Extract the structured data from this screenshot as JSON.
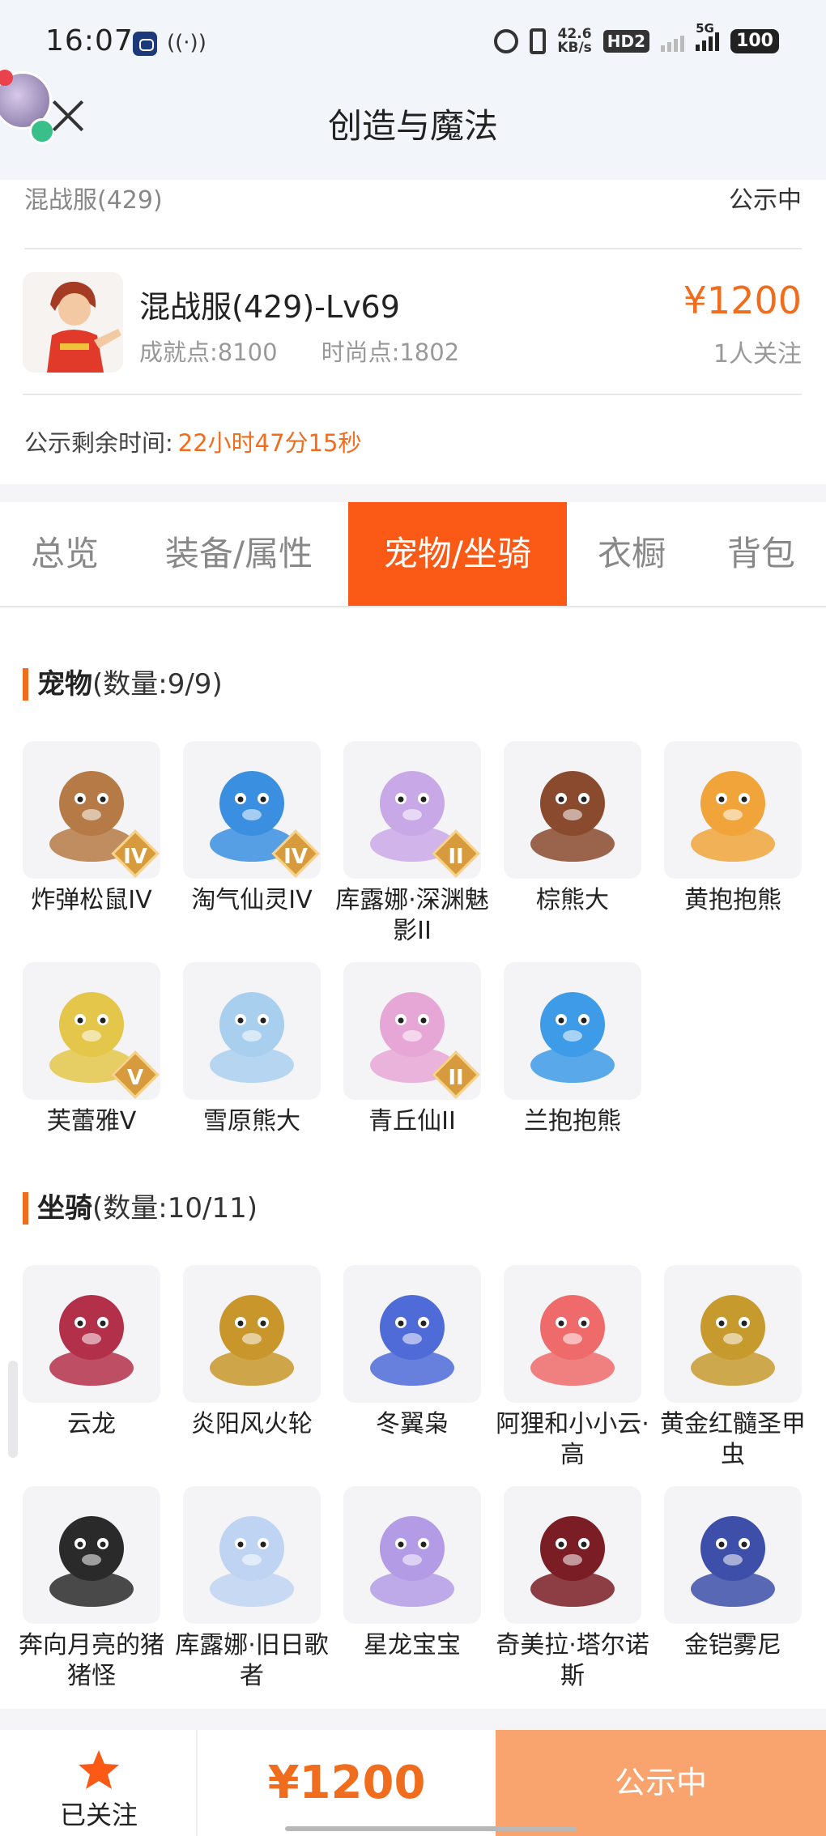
{
  "status_bar": {
    "time": "16:07",
    "net_speed_value": "42.6",
    "net_speed_unit": "KB/s",
    "hd_label": "HD2",
    "signal_label": "5G",
    "battery": "100"
  },
  "header": {
    "title": "创造与魔法"
  },
  "listing": {
    "server_label": "混战服(429)",
    "state": "公示中",
    "account_name": "混战服(429)-Lv69",
    "achievement": "成就点:8100",
    "fashion": "时尚点:1802",
    "price": "¥1200",
    "followers": "1人关注",
    "remaining_label": "公示剩余时间:",
    "remaining_value": "22小时47分15秒"
  },
  "tabs": [
    {
      "label": "总览"
    },
    {
      "label": "装备/属性"
    },
    {
      "label": "宠物/坐骑"
    },
    {
      "label": "衣橱"
    },
    {
      "label": "背包"
    }
  ],
  "pets": {
    "title": "宠物",
    "count": "(数量:9/9)",
    "items": [
      {
        "name": "炸弹松鼠IV",
        "rank": "IV",
        "color": "#b57a45"
      },
      {
        "name": "淘气仙灵IV",
        "rank": "IV",
        "color": "#3b8fe0"
      },
      {
        "name": "库露娜·深渊魅影II",
        "rank": "II",
        "color": "#c9a8e8"
      },
      {
        "name": "棕熊大",
        "rank": "",
        "color": "#8a4a2e"
      },
      {
        "name": "黄抱抱熊",
        "rank": "",
        "color": "#f0a43a"
      },
      {
        "name": "芙蕾雅V",
        "rank": "V",
        "color": "#e3c64a"
      },
      {
        "name": "雪原熊大",
        "rank": "",
        "color": "#a9cfee"
      },
      {
        "name": "青丘仙II",
        "rank": "II",
        "color": "#e6a7d6"
      },
      {
        "name": "兰抱抱熊",
        "rank": "",
        "color": "#3d9be8"
      }
    ]
  },
  "mounts": {
    "title": "坐骑",
    "count": "(数量:10/11)",
    "items": [
      {
        "name": "云龙",
        "color": "#b3304a"
      },
      {
        "name": "炎阳风火轮",
        "color": "#c8962a"
      },
      {
        "name": "冬翼枭",
        "color": "#4e6bd8"
      },
      {
        "name": "阿狸和小小云·高",
        "color": "#ef6b6b"
      },
      {
        "name": "黄金红髓圣甲虫",
        "color": "#c79a2e"
      },
      {
        "name": "奔向月亮的猪猪怪",
        "color": "#2a2a2a"
      },
      {
        "name": "库露娜·旧日歌者",
        "color": "#bfd4f2"
      },
      {
        "name": "星龙宝宝",
        "color": "#b49be6"
      },
      {
        "name": "奇美拉·塔尔诺斯",
        "color": "#7a1d24"
      },
      {
        "name": "金铠雾尼",
        "color": "#3d4fa8"
      }
    ]
  },
  "bottom_bar": {
    "follow_label": "已关注",
    "price": "¥1200",
    "status_label": "公示中"
  },
  "colors": {
    "accent": "#f06d1e",
    "tab_active": "#fa5a15",
    "status_button": "#f9a46e"
  },
  "icons": {
    "close": "close-icon",
    "follow": "star-icon"
  }
}
